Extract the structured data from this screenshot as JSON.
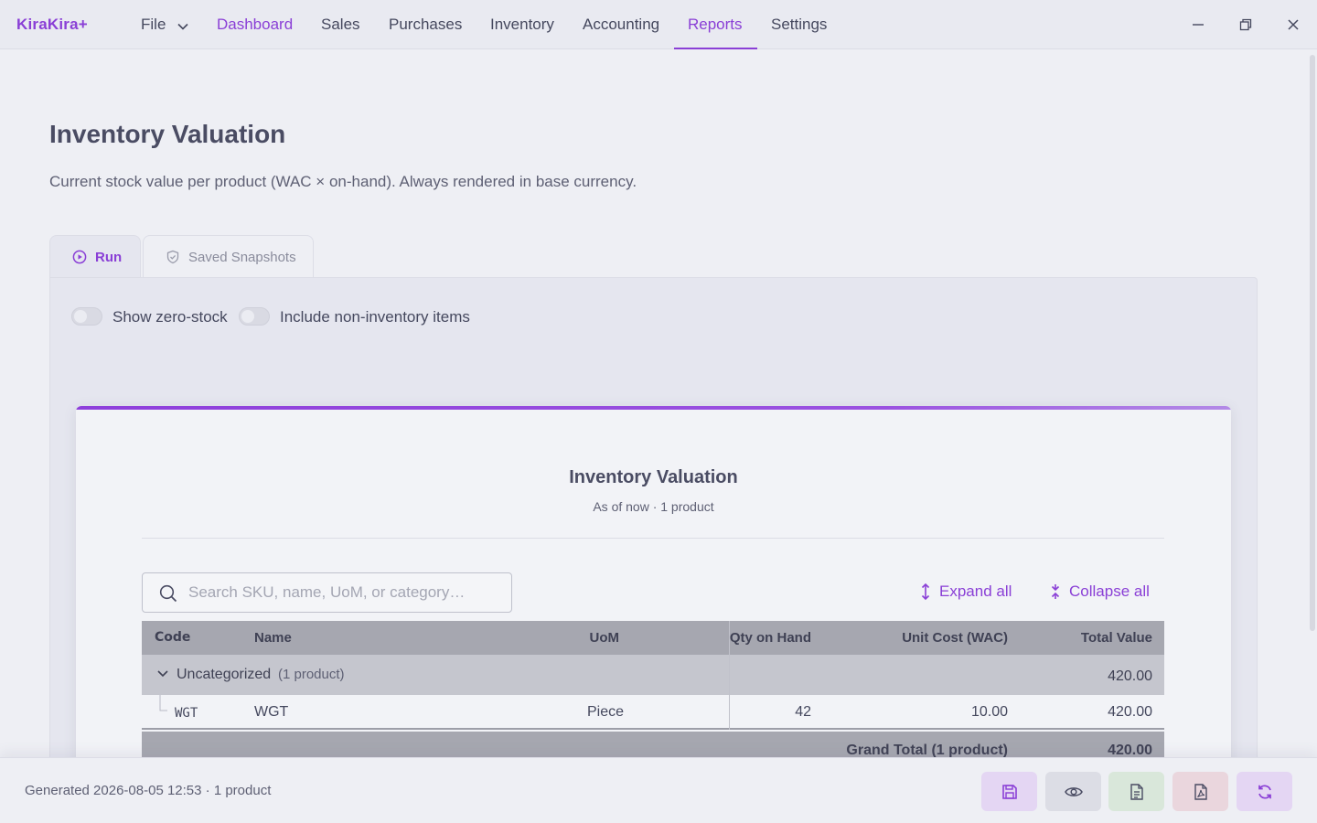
{
  "app": {
    "brand": "KiraKira+"
  },
  "menu": {
    "file": "File",
    "items": [
      "Dashboard",
      "Sales",
      "Purchases",
      "Inventory",
      "Accounting",
      "Reports",
      "Settings"
    ],
    "selected": "Reports"
  },
  "page": {
    "title": "Inventory Valuation",
    "subtitle": "Current stock value per product (WAC × on-hand). Always rendered in base currency."
  },
  "tabs": {
    "run": "Run",
    "snapshots": "Saved Snapshots"
  },
  "options": {
    "show_zero_stock": "Show zero-stock",
    "include_non_inventory": "Include non-inventory items"
  },
  "report": {
    "title": "Inventory Valuation",
    "subtitle": "As of now · 1 product",
    "search_placeholder": "Search SKU, name, UoM, or category…",
    "expand_all": "Expand all",
    "collapse_all": "Collapse all",
    "columns": {
      "code": "Code",
      "name": "Name",
      "uom": "UoM",
      "qty": "Qty on Hand",
      "unit_cost": "Unit Cost (WAC)",
      "total": "Total Value"
    },
    "group": {
      "name": "Uncategorized",
      "count": "(1 product)",
      "total": "420.00"
    },
    "rows": [
      {
        "code": "WGT",
        "name": "WGT",
        "uom": "Piece",
        "qty": "42",
        "unit_cost": "10.00",
        "total": "420.00"
      }
    ],
    "grand_total": {
      "label": "Grand Total (1 product)",
      "value": "420.00"
    }
  },
  "footer": {
    "generated": "Generated 2026-08-05 12:53 · 1 product",
    "buttons": [
      "save-icon",
      "eye-icon",
      "document-icon",
      "pdf-icon",
      "refresh-icon"
    ]
  },
  "colors": {
    "accent": "#8a3fd6",
    "save_bg": "#e4d6f3",
    "view_bg": "#dcdde5",
    "doc_bg": "#d9e7da",
    "pdf_bg": "#ead6dd",
    "refresh_bg": "#e4d6f3"
  }
}
